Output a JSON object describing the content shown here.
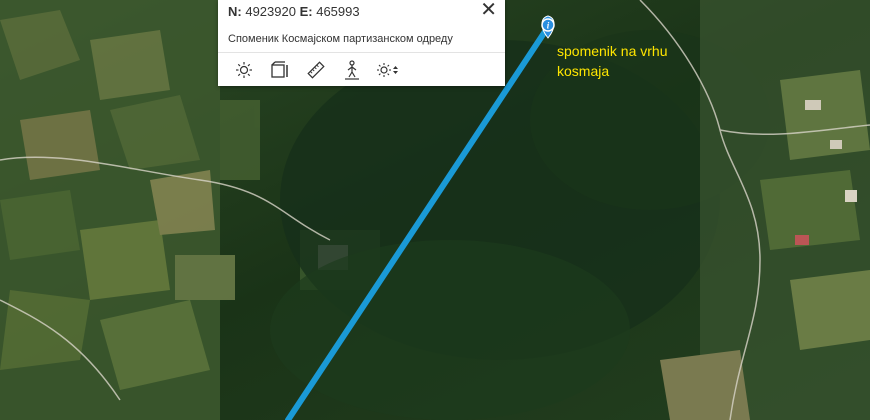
{
  "popup": {
    "north_label": "N:",
    "north_value": "4923920",
    "east_label": "E:",
    "east_value": "465993",
    "close_symbol": "✕",
    "poi_name": "Споменик Космајском партизанском одреду",
    "tools": [
      {
        "name": "sun-icon"
      },
      {
        "name": "3d-view-icon"
      },
      {
        "name": "measure-ruler-icon"
      },
      {
        "name": "route-walker-icon"
      },
      {
        "name": "sun-time-icon"
      }
    ]
  },
  "map": {
    "marker_icon": "info-marker-icon",
    "label_line1": "spomenik na vrhu",
    "label_line2": "kosmaja",
    "route_color": "#1a9ad6",
    "label_color": "#ffe600"
  }
}
